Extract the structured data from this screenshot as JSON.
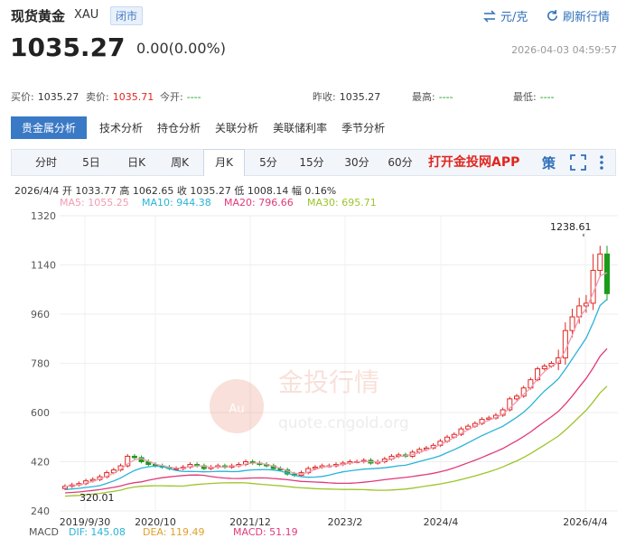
{
  "header": {
    "title": "现货黄金",
    "code": "XAU",
    "status": "闭市",
    "unit_button": "元/克",
    "refresh_button": "刷新行情"
  },
  "quote": {
    "price": "1035.27",
    "change": "0.00(0.00%)",
    "timestamp": "2026-04-03 04:59:57"
  },
  "stats": [
    {
      "label": "买价:",
      "value": "1035.27",
      "tone": "normal"
    },
    {
      "label": "卖价:",
      "value": "1035.71",
      "tone": "red"
    },
    {
      "label": "今开:",
      "value": "----",
      "tone": "grn"
    },
    {
      "label": "昨收:",
      "value": "1035.27",
      "tone": "normal"
    },
    {
      "label": "最高:",
      "value": "----",
      "tone": "grn"
    },
    {
      "label": "最低:",
      "value": "----",
      "tone": "grn"
    }
  ],
  "analysis_tabs": [
    "贵金属分析",
    "技术分析",
    "持仓分析",
    "关联分析",
    "美联储利率",
    "季节分析"
  ],
  "period_tabs": [
    "分时",
    "5日",
    "日K",
    "周K",
    "月K",
    "5分",
    "15分",
    "30分",
    "60分"
  ],
  "open_app": "打开金投网APP",
  "icons": {
    "strategy": "策",
    "fullscreen": "fullscreen-icon",
    "more": "more-vertical-icon"
  },
  "ohlc_line": "2026/4/4 开 1033.77 高 1062.65 收 1035.27 低 1008.14 幅 0.16%",
  "ma_labels": [
    {
      "text": "MA5: 1055.25",
      "color": "#f29bb2"
    },
    {
      "text": "MA10: 944.38",
      "color": "#29b3d8"
    },
    {
      "text": "MA20: 796.66",
      "color": "#e03a7a"
    },
    {
      "text": "MA30: 695.71",
      "color": "#9cc42b"
    }
  ],
  "watermark": {
    "brand": "金投行情",
    "url": "quote.cngold.org"
  },
  "bottom_labels": {
    "macd": "MACD",
    "dif": "DIF: 145.08",
    "dea": "DEA: 119.49",
    "macd_val": "MACD: 51.19"
  },
  "chart_data": {
    "type": "candlestick",
    "y_ticks": [
      240,
      420,
      600,
      780,
      960,
      1140,
      1320
    ],
    "ylim": [
      240,
      1320
    ],
    "x_ticks": [
      "2019/9/30",
      "2020/10",
      "2021/12",
      "2023/2",
      "2024/4",
      "2026/4/4"
    ],
    "annotations": {
      "max": "1238.61",
      "min": "320.01"
    },
    "candles_count": 79,
    "series": [
      {
        "name": "MA5",
        "color": "#f29bb2"
      },
      {
        "name": "MA10",
        "color": "#29b3d8"
      },
      {
        "name": "MA20",
        "color": "#e03a7a"
      },
      {
        "name": "MA30",
        "color": "#9cc42b"
      }
    ],
    "close": [
      330,
      335,
      340,
      350,
      355,
      365,
      380,
      390,
      405,
      440,
      435,
      420,
      410,
      405,
      400,
      395,
      395,
      400,
      410,
      405,
      395,
      400,
      405,
      400,
      405,
      410,
      420,
      415,
      410,
      405,
      395,
      390,
      375,
      370,
      380,
      395,
      400,
      405,
      405,
      410,
      415,
      420,
      420,
      425,
      415,
      420,
      430,
      440,
      445,
      440,
      455,
      465,
      470,
      480,
      495,
      510,
      520,
      540,
      550,
      560,
      575,
      580,
      590,
      610,
      650,
      660,
      690,
      720,
      760,
      770,
      780,
      800,
      900,
      950,
      990,
      1000,
      1120,
      1180,
      1035
    ]
  }
}
